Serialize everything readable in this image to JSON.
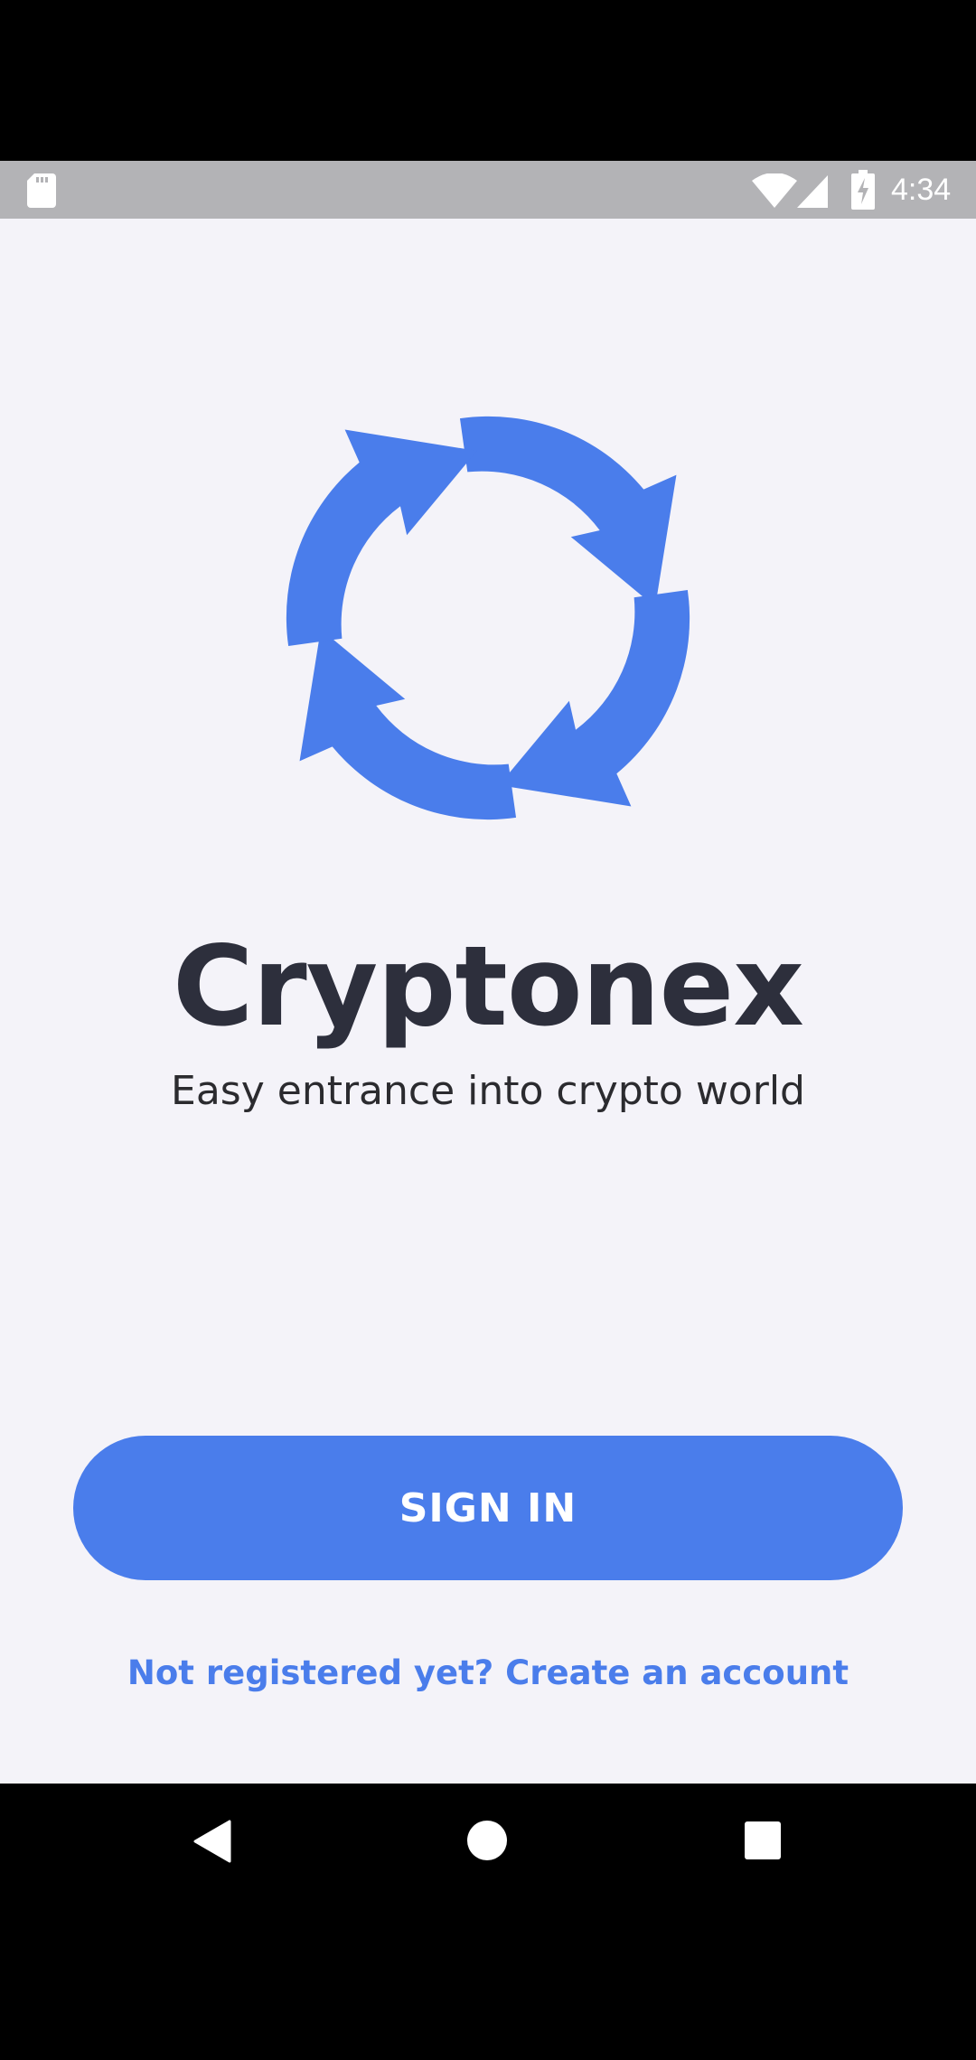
{
  "status_bar": {
    "time": "4:34",
    "icons": [
      "sd-card-icon",
      "wifi-icon",
      "cell-signal-icon",
      "battery-charging-icon"
    ]
  },
  "app": {
    "brand_name": "Cryptonex",
    "tagline": "Easy entrance into crypto world",
    "sign_in_label": "SIGN IN",
    "register_link": "Not registered yet? Create an account",
    "logo_icon": "circular-arrows-logo-icon"
  },
  "nav_bar": {
    "icons": [
      "back-icon",
      "home-icon",
      "recents-icon"
    ]
  },
  "colors": {
    "accent": "#4a7deb",
    "background": "#f4f3f9",
    "brand_text": "#2d2f3c",
    "status_bar": "#b3b3b6"
  }
}
